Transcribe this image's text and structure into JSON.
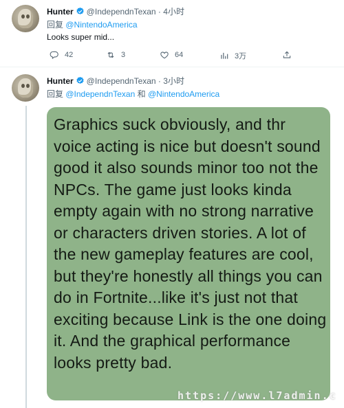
{
  "tweet1": {
    "name": "Hunter",
    "handle_time": "@IndependnTexan · 4小时",
    "reply_prefix": "回复 ",
    "reply_mention": "@NintendoAmerica",
    "text": "Looks super mid...",
    "actions": {
      "replies": "42",
      "retweets": "3",
      "likes": "64",
      "views": "3万"
    }
  },
  "tweet2": {
    "name": "Hunter",
    "handle_time": "@IndependnTexan · 3小时",
    "reply_prefix": "回复 ",
    "reply_mention_1": "@IndependnTexan",
    "reply_join": " 和 ",
    "reply_mention_2": "@NintendoAmerica",
    "image_text": "Graphics suck obviously, and thr voice acting is nice but doesn't sound good it also sounds minor too not the NPCs. The game just looks kinda empty again with no strong narrative or characters driven stories. A lot of the new gameplay features are cool, but they're honestly all things you can do in Fortnite...like it's just not that exciting because Link is the one doing it. And the graphical performance looks pretty bad."
  },
  "watermark": "https://www.l7admin.c",
  "colors": {
    "verified": "#1d9bf0",
    "mention": "#1d9bf0",
    "card_bg": "#8fb389",
    "muted": "#536471"
  },
  "icons": [
    "reply-icon",
    "retweet-icon",
    "like-icon",
    "views-icon",
    "share-icon",
    "verified-badge-icon"
  ]
}
